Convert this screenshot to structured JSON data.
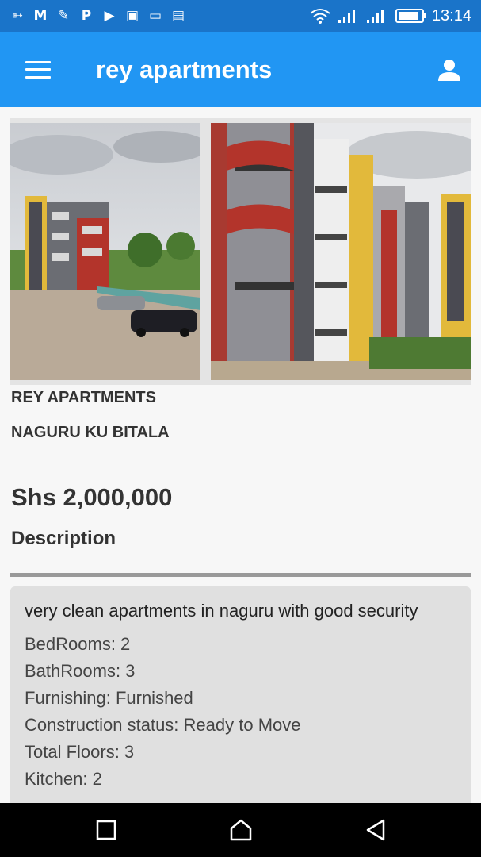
{
  "status_bar": {
    "time": "13:14",
    "battery_level": 0.9,
    "notification_icons": [
      "bird-app-icon",
      "gmail-icon",
      "pen-app-icon",
      "p-app-icon",
      "youtube-icon",
      "gallery-icon",
      "laptop-icon",
      "news-icon"
    ],
    "notification_glyphs": [
      "➳",
      "M",
      "✎",
      "P",
      "▶",
      "▣",
      "▭",
      "▤"
    ]
  },
  "app_bar": {
    "title": "rey apartments",
    "menu_icon": "hamburger-menu-icon",
    "profile_icon": "account-icon"
  },
  "listing": {
    "name": "REY APARTMENTS",
    "location": "NAGURU KU BITALA",
    "price": "Shs 2,000,000",
    "description_heading": "Description",
    "description": "very clean apartments in naguru with good security",
    "features": [
      "BedRooms: 2",
      "BathRooms: 3",
      "Furnishing: Furnished",
      "Construction status: Ready to Move",
      "Total Floors: 3",
      "Kitchen: 2"
    ]
  },
  "nav_bar": {
    "icons": [
      "recents-icon",
      "home-icon",
      "back-icon"
    ]
  },
  "colors": {
    "status_bar": "#1a74c9",
    "app_bar": "#2196f3",
    "background": "#f7f7f7",
    "description_box": "#e0e0e0"
  }
}
